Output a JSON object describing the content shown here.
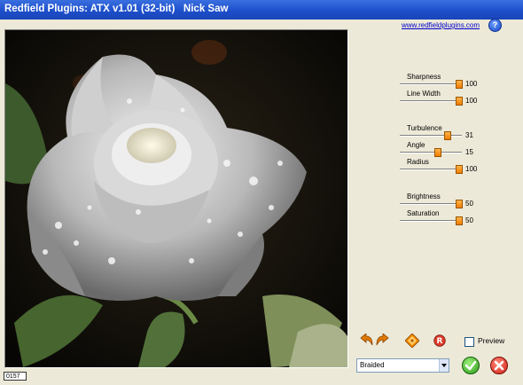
{
  "window": {
    "title": "Redfield Plugins: ATX v1.01 (32-bit)   Nick Saw"
  },
  "header": {
    "link": "www.redfieldplugins.com",
    "help": "?"
  },
  "sliders": [
    {
      "label": "Sharpness",
      "value": "100"
    },
    {
      "label": "Line Width",
      "value": "100"
    },
    {
      "label": "Turbulence",
      "value": "31"
    },
    {
      "label": "Angle",
      "value": "15"
    },
    {
      "label": "Radius",
      "value": "100"
    },
    {
      "label": "Brightness",
      "value": "50"
    },
    {
      "label": "Saturation",
      "value": "50"
    }
  ],
  "preview_checkbox": {
    "label": "Preview"
  },
  "style_select": {
    "selected": "Braided"
  },
  "status": {
    "code": "0157"
  },
  "icons": [
    "undo-arrow-icon",
    "redo-arrow-icon",
    "randomize-diamond-icon",
    "reset-r-icon",
    "ok-check-icon",
    "cancel-x-icon"
  ]
}
